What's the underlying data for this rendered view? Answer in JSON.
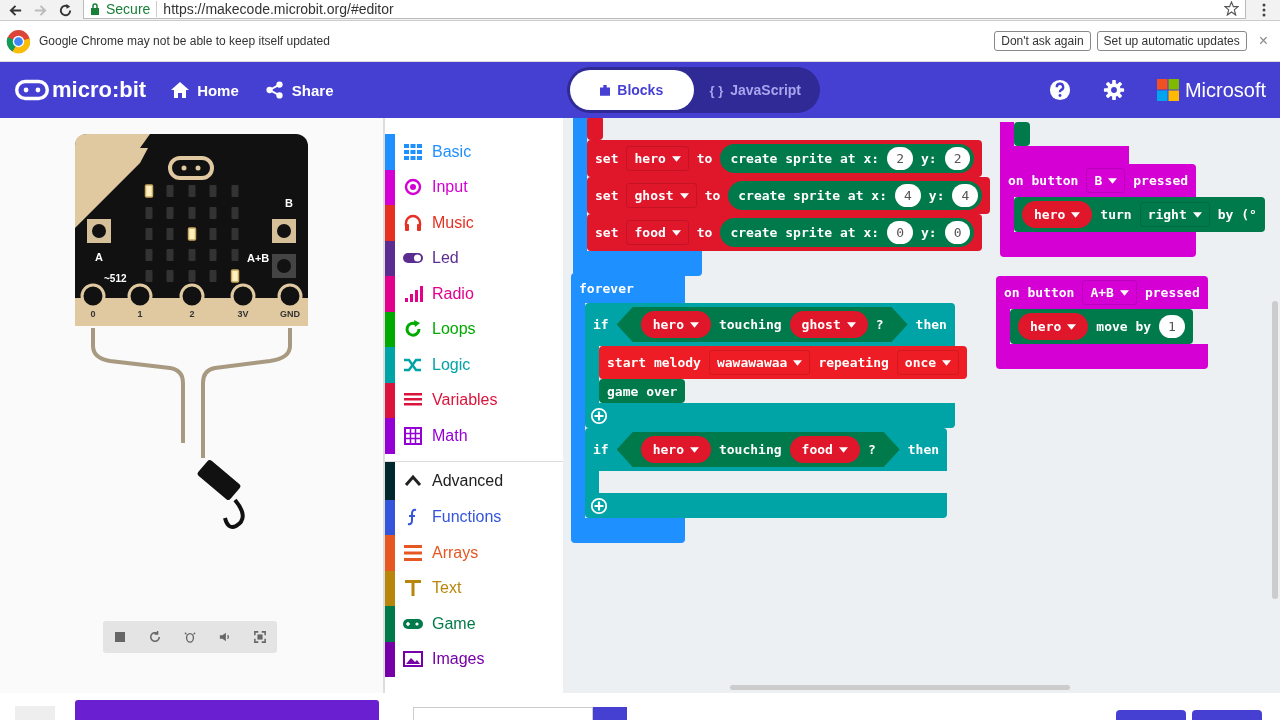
{
  "browser": {
    "secure_label": "Secure",
    "url": "https://makecode.microbit.org/#editor"
  },
  "infobar": {
    "message": "Google Chrome may not be able to keep itself updated",
    "buttons": [
      "Don't ask again",
      "Set up automatic updates"
    ],
    "close": "×"
  },
  "header": {
    "logo": "micro:bit",
    "nav": [
      "Home",
      "Share"
    ],
    "modes": [
      {
        "label": "Blocks",
        "selected": true
      },
      {
        "label": "JavaScript",
        "glyph": "{ }",
        "selected": false
      }
    ],
    "brand": "Microsoft"
  },
  "simulator": {
    "leds": [
      [
        true,
        false,
        false,
        false,
        false
      ],
      [
        false,
        false,
        false,
        false,
        false
      ],
      [
        false,
        false,
        true,
        false,
        false
      ],
      [
        false,
        false,
        false,
        false,
        false
      ],
      [
        false,
        false,
        false,
        false,
        true
      ]
    ],
    "pins": [
      "0",
      "1",
      "2",
      "3V",
      "GND"
    ],
    "pin_reading": "~512",
    "buttons": [
      "A",
      "B",
      "A+B"
    ]
  },
  "toolbox": {
    "categories": [
      {
        "kind": "category",
        "label": "Basic",
        "color": "#1e90ff"
      },
      {
        "kind": "category",
        "label": "Input",
        "color": "#d400d4"
      },
      {
        "kind": "category",
        "label": "Music",
        "color": "#e63022"
      },
      {
        "kind": "category",
        "label": "Led",
        "color": "#5c2d91"
      },
      {
        "kind": "category",
        "label": "Radio",
        "color": "#e3008c"
      },
      {
        "kind": "category",
        "label": "Loops",
        "color": "#00aa00"
      },
      {
        "kind": "category",
        "label": "Logic",
        "color": "#00a4a6"
      },
      {
        "kind": "category",
        "label": "Variables",
        "color": "#dc143c"
      },
      {
        "kind": "category",
        "label": "Math",
        "color": "#9400d3"
      },
      {
        "kind": "section",
        "label": "Advanced",
        "color": "#00272b"
      },
      {
        "kind": "category",
        "label": "Functions",
        "color": "#3455db"
      },
      {
        "kind": "category",
        "label": "Arrays",
        "color": "#e65722"
      },
      {
        "kind": "category",
        "label": "Text",
        "color": "#b8860b"
      },
      {
        "kind": "category",
        "label": "Game",
        "color": "#007a4b"
      },
      {
        "kind": "category",
        "label": "Images",
        "color": "#7600a8"
      }
    ]
  },
  "workspace": {
    "stacks": [
      {
        "kind": "c",
        "color": "#1e90ff",
        "children": [
          {
            "kind": "statement",
            "color": "#e0162b"
          },
          {
            "kind": "statement",
            "color": "#e0162b",
            "tokens": [
              {
                "kind": "text",
                "text": "set"
              },
              {
                "kind": "field",
                "text": "hero"
              },
              {
                "kind": "text",
                "text": "to"
              },
              {
                "kind": "reporter",
                "color": "#007a4b",
                "tokens": [
                  {
                    "kind": "text",
                    "text": "create sprite at x:"
                  },
                  {
                    "kind": "number",
                    "text": "2"
                  },
                  {
                    "kind": "text",
                    "text": "y:"
                  },
                  {
                    "kind": "number",
                    "text": "2"
                  }
                ]
              }
            ]
          },
          {
            "kind": "statement",
            "color": "#e0162b",
            "tokens": [
              {
                "kind": "text",
                "text": "set"
              },
              {
                "kind": "field",
                "text": "ghost"
              },
              {
                "kind": "text",
                "text": "to"
              },
              {
                "kind": "reporter",
                "color": "#007a4b",
                "tokens": [
                  {
                    "kind": "text",
                    "text": "create sprite at x:"
                  },
                  {
                    "kind": "number",
                    "text": "4"
                  },
                  {
                    "kind": "text",
                    "text": "y:"
                  },
                  {
                    "kind": "number",
                    "text": "4"
                  }
                ]
              }
            ]
          },
          {
            "kind": "statement",
            "color": "#e0162b",
            "tokens": [
              {
                "kind": "text",
                "text": "set"
              },
              {
                "kind": "field",
                "text": "food"
              },
              {
                "kind": "text",
                "text": "to"
              },
              {
                "kind": "reporter",
                "color": "#007a4b",
                "tokens": [
                  {
                    "kind": "text",
                    "text": "create sprite at x:"
                  },
                  {
                    "kind": "number",
                    "text": "0"
                  },
                  {
                    "kind": "text",
                    "text": "y:"
                  },
                  {
                    "kind": "number",
                    "text": "0"
                  }
                ]
              }
            ]
          }
        ]
      },
      {
        "kind": "c",
        "color": "#1e90ff",
        "tokens": [
          {
            "kind": "text",
            "text": "forever"
          }
        ],
        "children": [
          {
            "kind": "c",
            "color": "#00a4a6",
            "plus": true,
            "tokens": [
              {
                "kind": "text",
                "text": "if"
              },
              {
                "kind": "condition",
                "color": "#007a4b",
                "tokens": [
                  {
                    "kind": "var",
                    "color": "#e0162b",
                    "text": "hero"
                  },
                  {
                    "kind": "text",
                    "text": "touching"
                  },
                  {
                    "kind": "var",
                    "color": "#e0162b",
                    "text": "ghost"
                  },
                  {
                    "kind": "text",
                    "text": "?"
                  }
                ]
              },
              {
                "kind": "text",
                "text": "then"
              }
            ],
            "children": [
              {
                "kind": "statement",
                "color": "#ee1c24",
                "tokens": [
                  {
                    "kind": "text",
                    "text": "start melody"
                  },
                  {
                    "kind": "field",
                    "text": "wawawawaa"
                  },
                  {
                    "kind": "text",
                    "text": "repeating"
                  },
                  {
                    "kind": "field",
                    "text": "once"
                  }
                ]
              },
              {
                "kind": "statement",
                "color": "#007a4b",
                "tokens": [
                  {
                    "kind": "text",
                    "text": "game over"
                  }
                ]
              }
            ]
          },
          {
            "kind": "c",
            "color": "#00a4a6",
            "plus": true,
            "tokens": [
              {
                "kind": "text",
                "text": "if"
              },
              {
                "kind": "condition",
                "color": "#007a4b",
                "tokens": [
                  {
                    "kind": "var",
                    "color": "#e0162b",
                    "text": "hero"
                  },
                  {
                    "kind": "text",
                    "text": "touching"
                  },
                  {
                    "kind": "var",
                    "color": "#e0162b",
                    "text": "food"
                  },
                  {
                    "kind": "text",
                    "text": "?"
                  }
                ]
              },
              {
                "kind": "text",
                "text": "then"
              }
            ]
          }
        ]
      },
      {
        "kind": "c",
        "color": "#d400d4",
        "children": [
          {
            "kind": "statement",
            "color": "#007a4b"
          }
        ]
      },
      {
        "kind": "c",
        "color": "#d400d4",
        "tokens": [
          {
            "kind": "text",
            "text": "on button"
          },
          {
            "kind": "field",
            "text": "B"
          },
          {
            "kind": "text",
            "text": "pressed"
          }
        ],
        "children": [
          {
            "kind": "statement",
            "color": "#007a4b",
            "tokens": [
              {
                "kind": "var",
                "color": "#e0162b",
                "text": "hero"
              },
              {
                "kind": "text",
                "text": "turn"
              },
              {
                "kind": "field",
                "text": "right"
              },
              {
                "kind": "text",
                "text": "by (°"
              }
            ]
          }
        ]
      },
      {
        "kind": "c",
        "color": "#d400d4",
        "tokens": [
          {
            "kind": "text",
            "text": "on button"
          },
          {
            "kind": "field",
            "text": "A+B"
          },
          {
            "kind": "text",
            "text": "pressed"
          }
        ],
        "children": [
          {
            "kind": "statement",
            "color": "#007a4b",
            "tokens": [
              {
                "kind": "var",
                "color": "#e0162b",
                "text": "hero"
              },
              {
                "kind": "text",
                "text": "move by"
              },
              {
                "kind": "number",
                "text": "1"
              }
            ]
          }
        ]
      }
    ]
  }
}
